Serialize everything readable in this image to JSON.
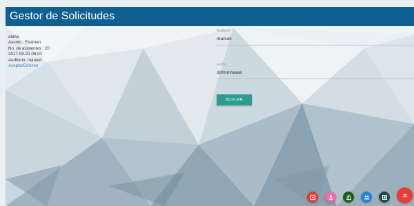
{
  "header": {
    "title": "Gestor de Solicitudes"
  },
  "request": {
    "user": "alana",
    "subject": "Asunto : Examen",
    "attendees": "No. de asistentes : 20",
    "datetime": "2017-09-21 08:00",
    "auditorium": "Auditorio: manuel",
    "accept_label": "Aceptar",
    "delete_label": "Eliminar"
  },
  "filters": {
    "auditorium_label": "Auditorio",
    "auditorium_value": "manuel",
    "date_label": "Fecha",
    "date_value": "dd/mm/aaaa",
    "search_label": "BUSCAR"
  },
  "fabs": [
    {
      "icon": "add-box-icon",
      "color": "#e53935"
    },
    {
      "icon": "person-icon",
      "color": "#e96fa6"
    },
    {
      "icon": "bank-icon",
      "color": "#1b5e20"
    },
    {
      "icon": "group-icon",
      "color": "#2a82d6"
    },
    {
      "icon": "square-icon",
      "color": "#1f4b4b"
    },
    {
      "icon": "menu-icon",
      "color": "#f03a36"
    }
  ],
  "colors": {
    "header": "#0f5f90",
    "accent": "#2a9d8f",
    "link": "#2f86c8"
  }
}
